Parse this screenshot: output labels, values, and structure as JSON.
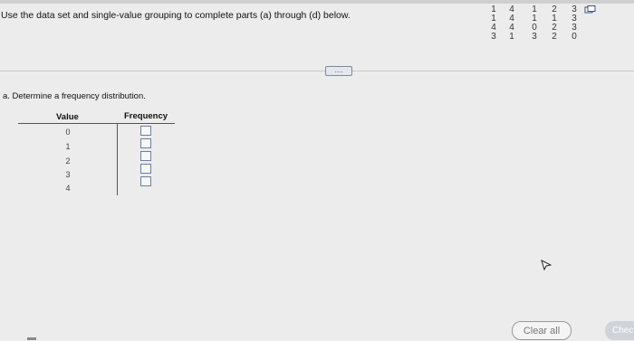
{
  "instruction": "Use the data set and single-value grouping to complete parts (a) through (d) below.",
  "data_set": {
    "columns": [
      [
        "1",
        "1",
        "4",
        "3"
      ],
      [
        "4",
        "4",
        "4",
        "1"
      ],
      [
        "1",
        "1",
        "0",
        "3"
      ],
      [
        "2",
        "1",
        "2",
        "2"
      ],
      [
        "3",
        "3",
        "3",
        "0"
      ]
    ]
  },
  "copy_icon": "copy-data-icon",
  "expand_button": "....",
  "question": "a. Determine a frequency distribution.",
  "table": {
    "value_header": "Value",
    "frequency_header": "Frequency",
    "values": [
      "0",
      "1",
      "2",
      "3",
      "4"
    ]
  },
  "buttons": {
    "clear_all": "Clear all",
    "check": "Chec"
  }
}
